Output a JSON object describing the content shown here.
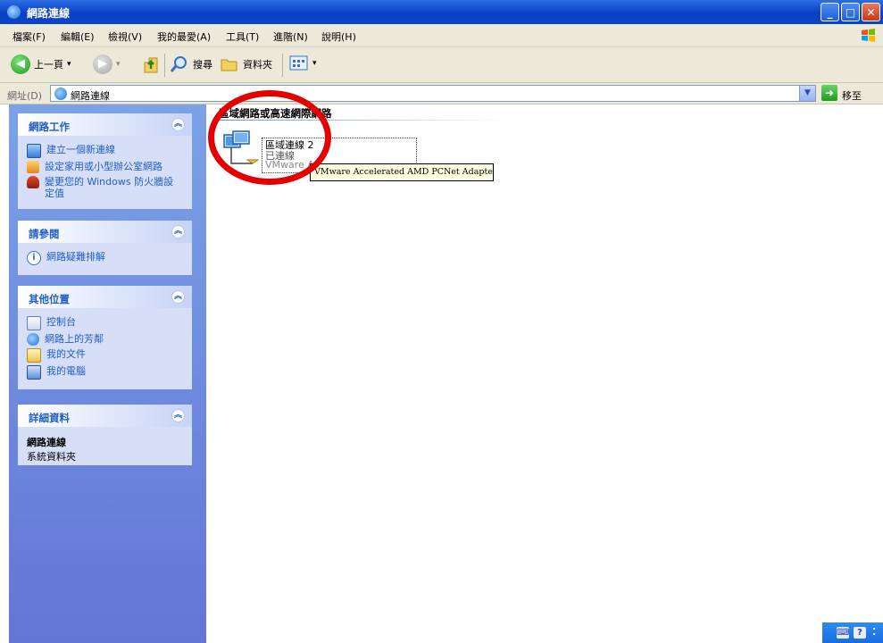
{
  "window": {
    "title": "網路連線"
  },
  "menu": [
    "檔案(F)",
    "編輯(E)",
    "檢視(V)",
    "我的最愛(A)",
    "工具(T)",
    "進階(N)",
    "說明(H)"
  ],
  "toolbar": {
    "back": "上一頁",
    "search": "搜尋",
    "folders": "資料夾"
  },
  "address": {
    "label": "網址(D)",
    "value": "網路連線",
    "go": "移至"
  },
  "panels": {
    "tasks": {
      "title": "網路工作",
      "items": [
        "建立一個新連線",
        "設定家用或小型辦公室網路",
        "變更您的 Windows 防火牆設定值"
      ]
    },
    "seealso": {
      "title": "請參閱",
      "items": [
        "網路疑難排解"
      ]
    },
    "places": {
      "title": "其他位置",
      "items": [
        "控制台",
        "網路上的芳鄰",
        "我的文件",
        "我的電腦"
      ]
    },
    "details": {
      "title": "詳細資料",
      "name": "網路連線",
      "type": "系統資料夾"
    }
  },
  "content": {
    "group_title": "區域網路或高速網際網路",
    "connection": {
      "name": "區域連線 2",
      "status": "已連線",
      "device": "VMware A"
    },
    "tooltip": "VMware Accelerated AMD PCNet Adapter"
  },
  "tray": {
    "help": "?"
  }
}
